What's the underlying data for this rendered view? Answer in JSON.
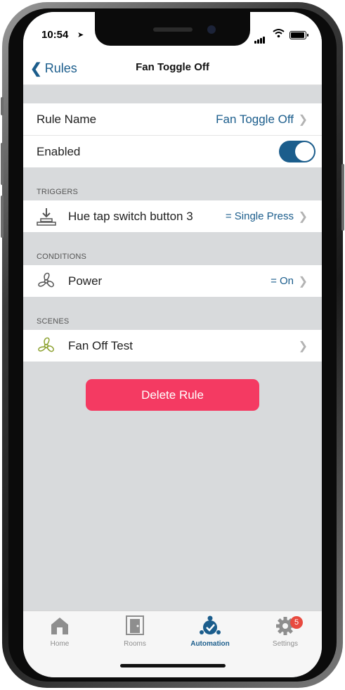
{
  "status": {
    "time": "10:54"
  },
  "nav": {
    "back_label": "Rules",
    "title": "Fan Toggle Off"
  },
  "rule": {
    "name_label": "Rule Name",
    "name_value": "Fan Toggle Off",
    "enabled_label": "Enabled",
    "enabled": true
  },
  "triggers": {
    "header": "TRIGGERS",
    "items": [
      {
        "icon": "tap-switch-icon",
        "label": "Hue tap switch button 3",
        "value": "= Single Press"
      }
    ]
  },
  "conditions": {
    "header": "CONDITIONS",
    "items": [
      {
        "icon": "fan-icon",
        "label": "Power",
        "value": "= On"
      }
    ]
  },
  "scenes": {
    "header": "SCENES",
    "items": [
      {
        "icon": "fan-scene-icon",
        "label": "Fan Off Test"
      }
    ]
  },
  "delete_label": "Delete Rule",
  "tabs": [
    {
      "label": "Home",
      "icon": "home-icon"
    },
    {
      "label": "Rooms",
      "icon": "door-icon"
    },
    {
      "label": "Automation",
      "icon": "automation-icon",
      "active": true
    },
    {
      "label": "Settings",
      "icon": "gear-icon",
      "badge": "5"
    }
  ],
  "colors": {
    "accent": "#1b5d8c",
    "delete": "#f43a62",
    "background": "#d8dadc",
    "badge": "#e84a3f"
  }
}
